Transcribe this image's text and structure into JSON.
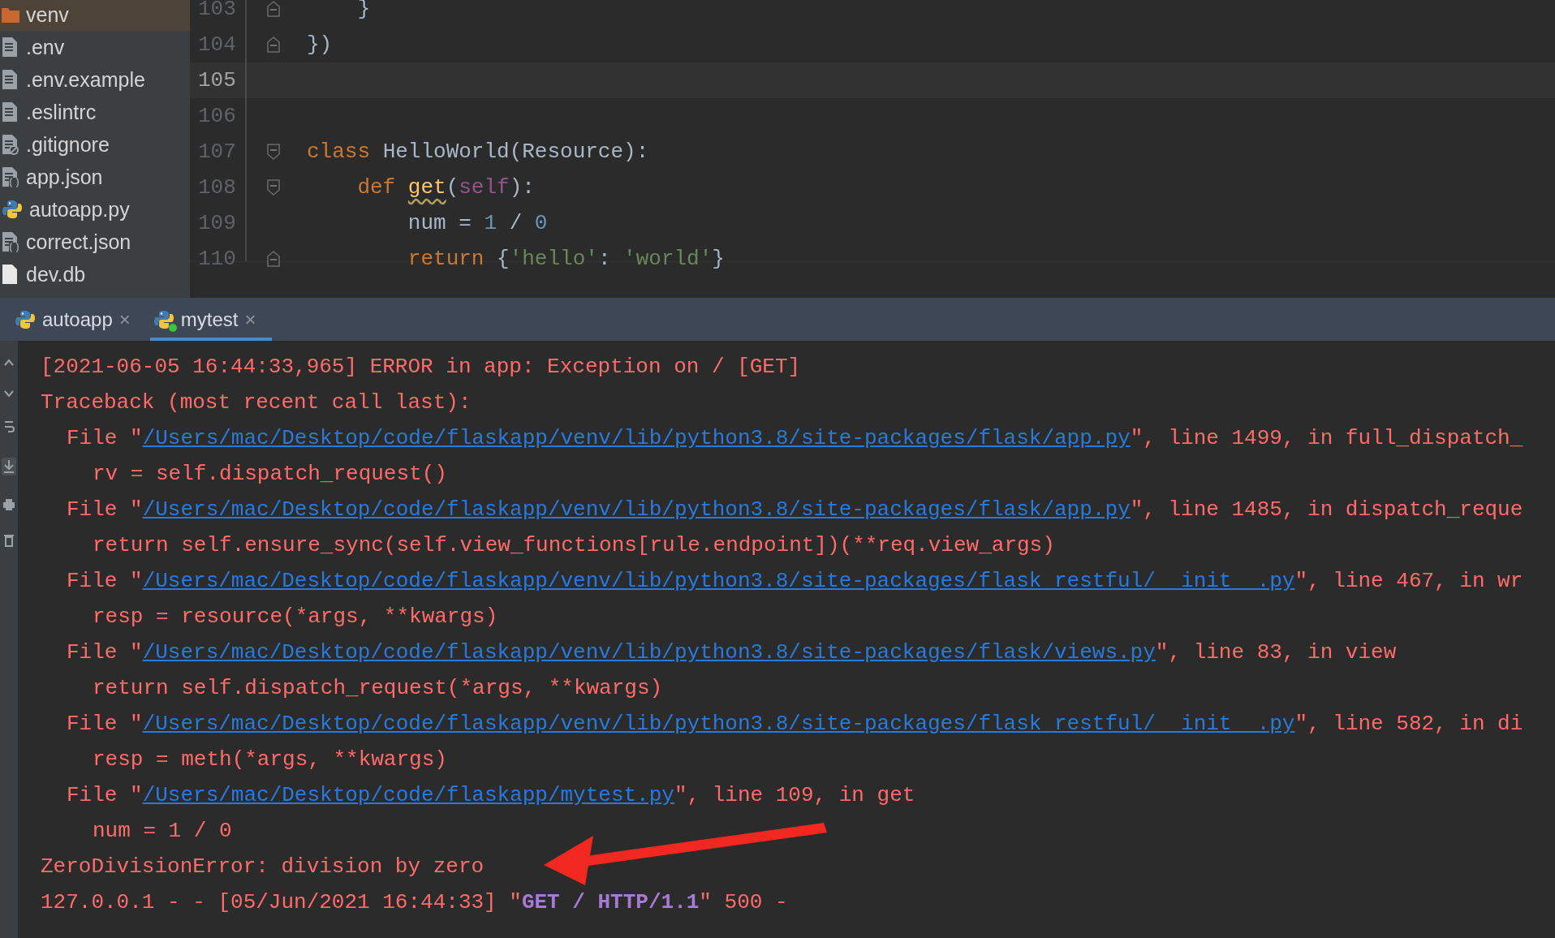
{
  "project_tree": {
    "items": [
      {
        "name": "venv",
        "kind": "folder",
        "selected": true
      },
      {
        "name": ".env",
        "kind": "text",
        "selected": false
      },
      {
        "name": ".env.example",
        "kind": "text",
        "selected": false
      },
      {
        "name": ".eslintrc",
        "kind": "text",
        "selected": false
      },
      {
        "name": ".gitignore",
        "kind": "ignore",
        "selected": false
      },
      {
        "name": "app.json",
        "kind": "json",
        "selected": false
      },
      {
        "name": "autoapp.py",
        "kind": "python",
        "selected": false
      },
      {
        "name": "correct.json",
        "kind": "json",
        "selected": false
      },
      {
        "name": "dev.db",
        "kind": "file",
        "selected": false
      }
    ]
  },
  "editor": {
    "lines": [
      {
        "number": "103",
        "current": false,
        "fold_start": false,
        "fold_end": true,
        "tokens": [
          {
            "kind": "plain",
            "text": "    }"
          }
        ]
      },
      {
        "number": "104",
        "current": false,
        "fold_start": false,
        "fold_end": true,
        "tokens": [
          {
            "kind": "plain",
            "text": "})"
          }
        ]
      },
      {
        "number": "105",
        "current": true,
        "fold_start": false,
        "fold_end": false
      },
      {
        "number": "106",
        "current": false,
        "fold_start": false,
        "fold_end": false
      },
      {
        "number": "107",
        "current": false,
        "fold_start": true,
        "fold_end": false,
        "tokens": [
          {
            "kind": "keyword",
            "text": "class "
          },
          {
            "kind": "plain",
            "text": "HelloWorld(Resource):"
          }
        ]
      },
      {
        "number": "108",
        "current": false,
        "fold_start": true,
        "fold_end": false,
        "tokens": [
          {
            "kind": "keyword",
            "text": "    def "
          },
          {
            "kind": "function",
            "text": "get",
            "warning": true
          },
          {
            "kind": "plain",
            "text": "("
          },
          {
            "kind": "self",
            "text": "self"
          },
          {
            "kind": "plain",
            "text": "):"
          }
        ]
      },
      {
        "number": "109",
        "current": false,
        "fold_start": false,
        "fold_end": false,
        "tokens": [
          {
            "kind": "plain",
            "text": "        num = "
          },
          {
            "kind": "number",
            "text": "1"
          },
          {
            "kind": "plain",
            "text": " / "
          },
          {
            "kind": "number",
            "text": "0"
          }
        ]
      },
      {
        "number": "110",
        "current": false,
        "fold_start": false,
        "fold_end": true,
        "tokens": [
          {
            "kind": "keyword",
            "text": "        return "
          },
          {
            "kind": "plain",
            "text": "{"
          },
          {
            "kind": "string",
            "text": "'hello'"
          },
          {
            "kind": "plain",
            "text": ": "
          },
          {
            "kind": "string",
            "text": "'world'"
          },
          {
            "kind": "plain",
            "text": "}"
          }
        ]
      }
    ]
  },
  "run_tabs": [
    {
      "label": "autoapp",
      "selected": false,
      "running": false,
      "close": "×"
    },
    {
      "label": "mytest",
      "selected": true,
      "running": true,
      "close": "×"
    }
  ],
  "console": {
    "lines": [
      {
        "kind": "message",
        "parts": [
          {
            "kind": "text",
            "text": "[2021-06-05 16:44:33,965] ERROR in app: Exception on / [GET]"
          }
        ]
      },
      {
        "kind": "message",
        "parts": [
          {
            "kind": "text",
            "text": "Traceback (most recent call last):"
          }
        ]
      },
      {
        "kind": "frame",
        "parts": [
          {
            "kind": "text",
            "text": "File \""
          },
          {
            "kind": "link",
            "text": "/Users/mac/Desktop/code/flaskapp/venv/lib/python3.8/site-packages/flask/app.py"
          },
          {
            "kind": "text",
            "text": "\", line 1499, in full_dispatch_"
          }
        ]
      },
      {
        "kind": "source",
        "parts": [
          {
            "kind": "text",
            "text": "rv = self.dispatch_request()"
          }
        ]
      },
      {
        "kind": "frame",
        "parts": [
          {
            "kind": "text",
            "text": "File \""
          },
          {
            "kind": "link",
            "text": "/Users/mac/Desktop/code/flaskapp/venv/lib/python3.8/site-packages/flask/app.py"
          },
          {
            "kind": "text",
            "text": "\", line 1485, in dispatch_reque"
          }
        ]
      },
      {
        "kind": "source",
        "parts": [
          {
            "kind": "text",
            "text": "return self.ensure_sync(self.view_functions[rule.endpoint])(**req.view_args)"
          }
        ]
      },
      {
        "kind": "frame",
        "parts": [
          {
            "kind": "text",
            "text": "File \""
          },
          {
            "kind": "link",
            "text": "/Users/mac/Desktop/code/flaskapp/venv/lib/python3.8/site-packages/flask_restful/__init__.py"
          },
          {
            "kind": "text",
            "text": "\", line 467, in wr"
          }
        ]
      },
      {
        "kind": "source",
        "parts": [
          {
            "kind": "text",
            "text": "resp = resource(*args, **kwargs)"
          }
        ]
      },
      {
        "kind": "frame",
        "parts": [
          {
            "kind": "text",
            "text": "File \""
          },
          {
            "kind": "link",
            "text": "/Users/mac/Desktop/code/flaskapp/venv/lib/python3.8/site-packages/flask/views.py"
          },
          {
            "kind": "text",
            "text": "\", line 83, in view"
          }
        ]
      },
      {
        "kind": "source",
        "parts": [
          {
            "kind": "text",
            "text": "return self.dispatch_request(*args, **kwargs)"
          }
        ]
      },
      {
        "kind": "frame",
        "parts": [
          {
            "kind": "text",
            "text": "File \""
          },
          {
            "kind": "link",
            "text": "/Users/mac/Desktop/code/flaskapp/venv/lib/python3.8/site-packages/flask_restful/__init__.py"
          },
          {
            "kind": "text",
            "text": "\", line 582, in di"
          }
        ]
      },
      {
        "kind": "source",
        "parts": [
          {
            "kind": "text",
            "text": "resp = meth(*args, **kwargs)"
          }
        ]
      },
      {
        "kind": "frame",
        "parts": [
          {
            "kind": "text",
            "text": "File \""
          },
          {
            "kind": "link",
            "text": "/Users/mac/Desktop/code/flaskapp/mytest.py"
          },
          {
            "kind": "text",
            "text": "\", line 109, in get"
          }
        ]
      },
      {
        "kind": "source",
        "parts": [
          {
            "kind": "text",
            "text": "num = 1 / 0"
          }
        ]
      },
      {
        "kind": "message",
        "parts": [
          {
            "kind": "text",
            "text": "ZeroDivisionError: division by zero"
          }
        ]
      },
      {
        "kind": "message",
        "parts": [
          {
            "kind": "text",
            "text": "127.0.0.1 - - [05/Jun/2021 16:44:33] \""
          },
          {
            "kind": "request",
            "text": "GET / HTTP/1.1"
          },
          {
            "kind": "text",
            "text": "\" 500 -"
          }
        ]
      }
    ]
  }
}
